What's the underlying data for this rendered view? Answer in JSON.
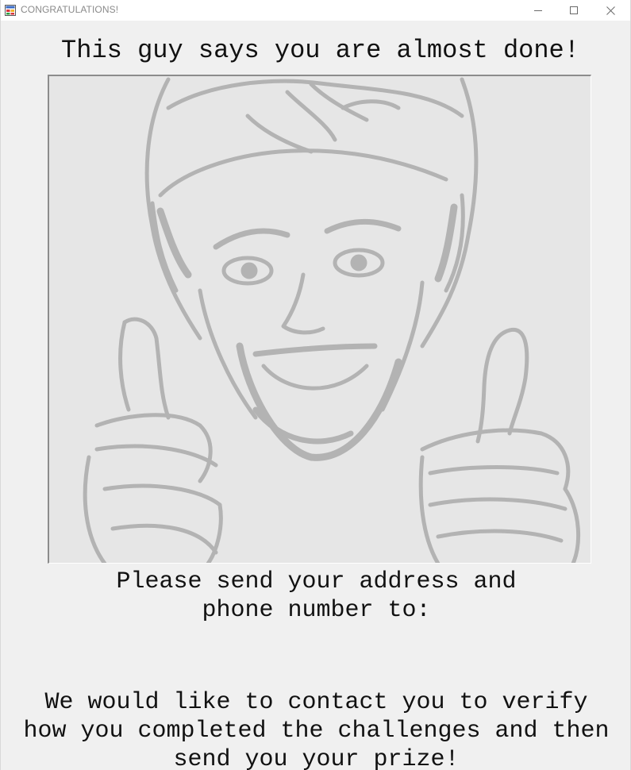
{
  "window": {
    "title": "CONGRATULATIONS!",
    "icon": "app-window-icon",
    "controls": {
      "minimize": "minimize-icon",
      "maximize": "maximize-icon",
      "close": "close-icon"
    }
  },
  "content": {
    "heading": "This guy says you are almost done!",
    "picture": {
      "description_icon": "thumbs-up-guy-sketch"
    },
    "send_lines": [
      "Please send your address and",
      "phone number to:"
    ],
    "contact_lines": [
      "We would like to contact you to verify",
      "how you completed the challenges and then",
      "send you your prize!"
    ]
  },
  "colors": {
    "background": "#f0f0f0",
    "titlebar": "#ffffff",
    "title_text": "#8a8a8a",
    "text": "#111111",
    "sketch": "#b5b5b5"
  }
}
